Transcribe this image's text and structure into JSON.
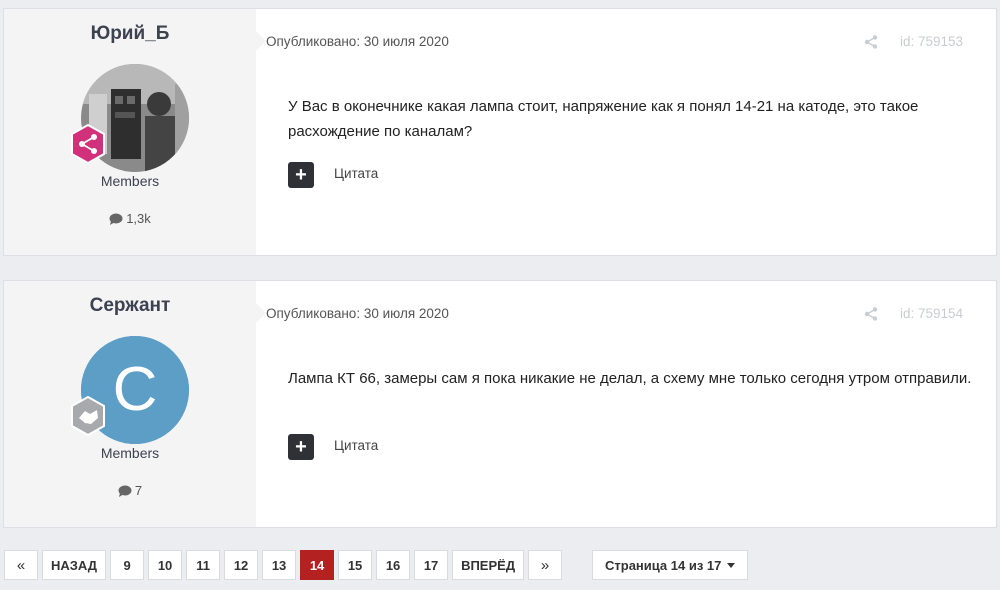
{
  "posts": [
    {
      "author": "Юрий_Б",
      "avatar_type": "photo",
      "rank_icon": "share-icon",
      "rank_color": "#d1307a",
      "group": "Members",
      "post_count": "1,3k",
      "published": "Опубликовано: 30 июля 2020",
      "id": "id: 759153",
      "text": "У Вас в оконечнике какая лампа стоит, напряжение как я понял 14-21 на катоде, это такое расхождение по каналам?",
      "quote_label": "Цитата"
    },
    {
      "author": "Сержант",
      "avatar_type": "letter",
      "avatar_letter": "С",
      "avatar_color": "#5d9ec7",
      "rank_icon": "handshake-icon",
      "rank_color": "#a7a9ad",
      "group": "Members",
      "post_count": "7",
      "published": "Опубликовано: 30 июля 2020",
      "id": "id: 759154",
      "text": "Лампа КТ 66, замеры сам я пока никакие не делал, а схему мне только сегодня утром отправили.",
      "quote_label": "Цитата"
    }
  ],
  "pagination": {
    "first": "«",
    "prev": "НАЗАД",
    "pages": [
      "9",
      "10",
      "11",
      "12",
      "13",
      "14",
      "15",
      "16",
      "17"
    ],
    "current": "14",
    "next": "ВПЕРЁД",
    "last": "»",
    "page_jump": "Страница 14 из 17"
  },
  "colors": {
    "active_page": "#b42121",
    "background": "#ebedf0"
  }
}
